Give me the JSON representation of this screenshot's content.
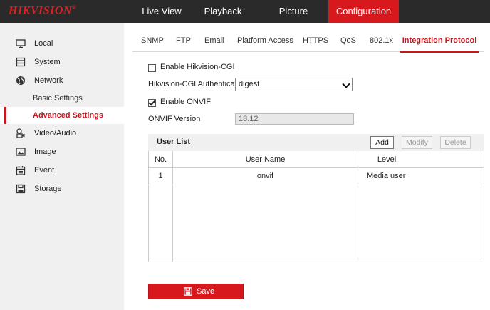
{
  "brand": {
    "logo_text": "HIKVISION",
    "trademark": "®"
  },
  "top_nav": {
    "tabs": [
      {
        "label": "Live View"
      },
      {
        "label": "Playback"
      },
      {
        "label": "Picture"
      },
      {
        "label": "Configuration",
        "active": true
      }
    ]
  },
  "sidebar": {
    "items": [
      {
        "label": "Local",
        "icon": "monitor-icon"
      },
      {
        "label": "System",
        "icon": "system-icon"
      },
      {
        "label": "Network",
        "icon": "globe-icon"
      },
      {
        "label": "Video/Audio",
        "icon": "video-audio-icon"
      },
      {
        "label": "Image",
        "icon": "image-icon"
      },
      {
        "label": "Event",
        "icon": "calendar-icon"
      },
      {
        "label": "Storage",
        "icon": "storage-icon"
      }
    ],
    "network_sub": [
      {
        "label": "Basic Settings"
      },
      {
        "label": "Advanced Settings",
        "active": true
      }
    ]
  },
  "sub_tabs": [
    {
      "label": "SNMP"
    },
    {
      "label": "FTP"
    },
    {
      "label": "Email"
    },
    {
      "label": "Platform Access"
    },
    {
      "label": "HTTPS"
    },
    {
      "label": "QoS"
    },
    {
      "label": "802.1x"
    },
    {
      "label": "Integration Protocol",
      "active": true
    }
  ],
  "form": {
    "enable_hikcgi": {
      "label": "Enable Hikvision-CGI",
      "checked": false
    },
    "hikcgi_auth": {
      "label": "Hikvision-CGI Authenticat...",
      "value": "digest"
    },
    "enable_onvif": {
      "label": "Enable ONVIF",
      "checked": true
    },
    "onvif_version": {
      "label": "ONVIF Version",
      "value": "18.12"
    }
  },
  "user_list": {
    "title": "User List",
    "buttons": {
      "add": "Add",
      "modify": "Modify",
      "delete": "Delete"
    },
    "columns": [
      "No.",
      "User Name",
      "Level"
    ],
    "rows": [
      {
        "no": "1",
        "user_name": "onvif",
        "level": "Media user"
      }
    ]
  },
  "save_button": {
    "label": "Save"
  },
  "colors": {
    "accent": "#d7191e",
    "topbar": "#2a2a2a",
    "sidebar": "#f0f0f0"
  }
}
